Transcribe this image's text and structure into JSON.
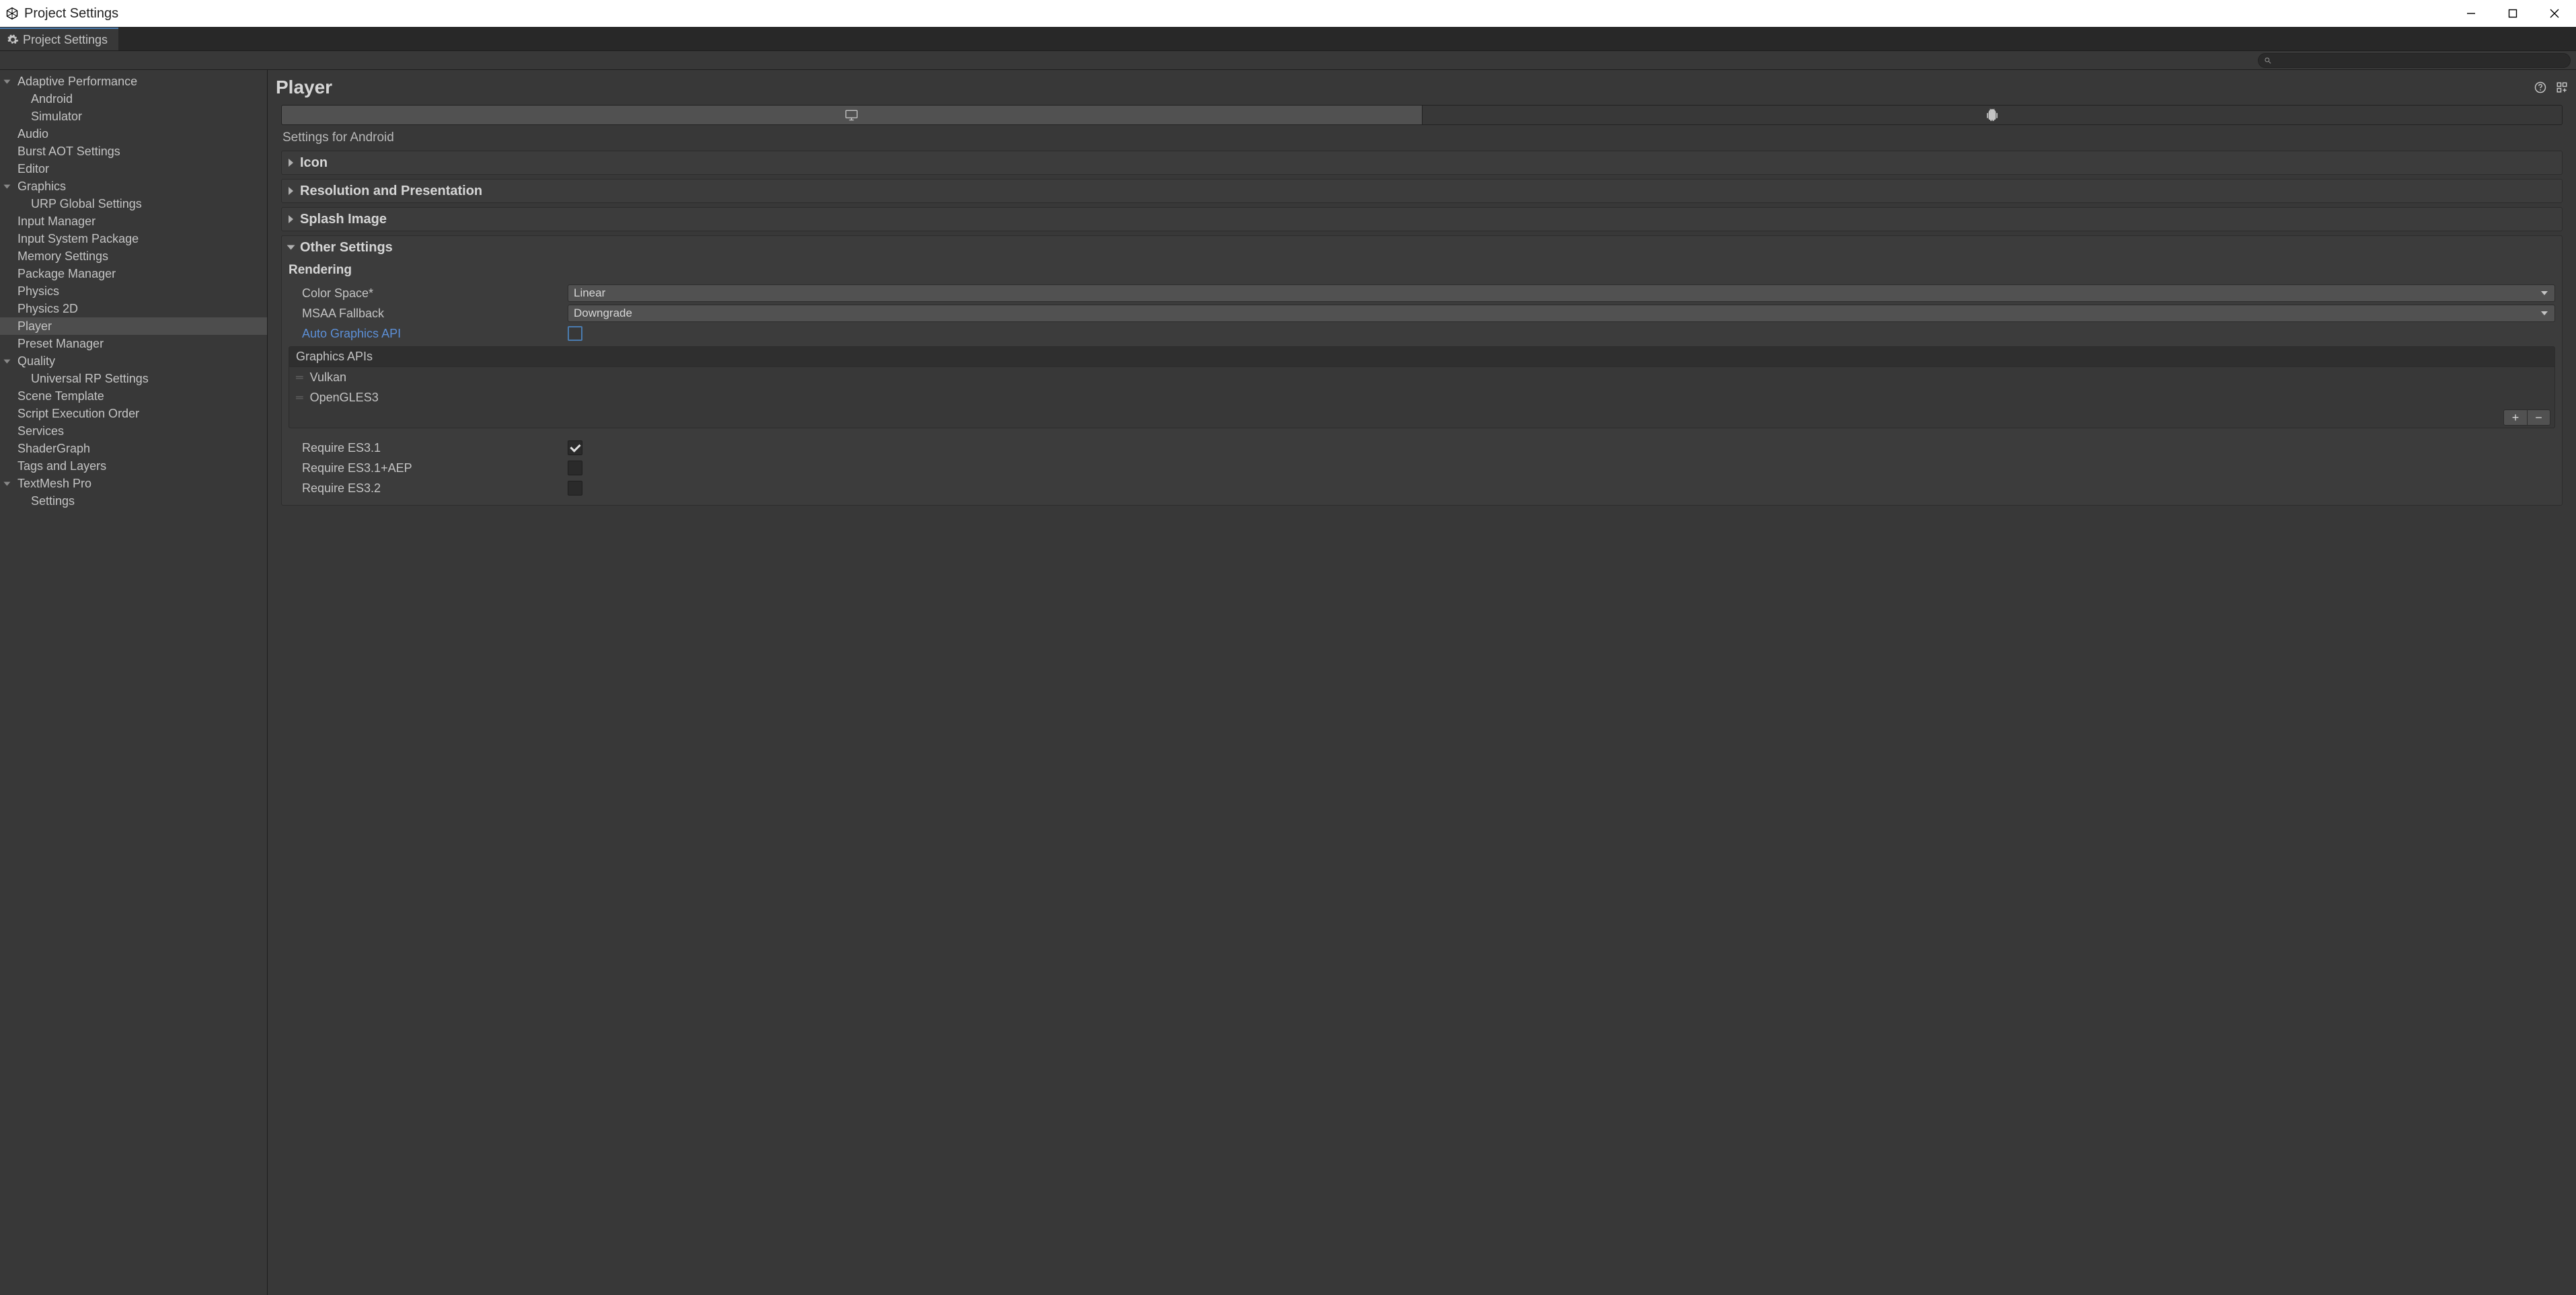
{
  "window": {
    "title": "Project Settings"
  },
  "tab": {
    "label": "Project Settings"
  },
  "search": {
    "placeholder": ""
  },
  "sidebar": {
    "items": [
      {
        "label": "Adaptive Performance",
        "expandable": true,
        "expanded": true,
        "depth": 0
      },
      {
        "label": "Android",
        "depth": 1
      },
      {
        "label": "Simulator",
        "depth": 1
      },
      {
        "label": "Audio",
        "depth": 0
      },
      {
        "label": "Burst AOT Settings",
        "depth": 0
      },
      {
        "label": "Editor",
        "depth": 0
      },
      {
        "label": "Graphics",
        "expandable": true,
        "expanded": true,
        "depth": 0
      },
      {
        "label": "URP Global Settings",
        "depth": 1
      },
      {
        "label": "Input Manager",
        "depth": 0
      },
      {
        "label": "Input System Package",
        "depth": 0
      },
      {
        "label": "Memory Settings",
        "depth": 0
      },
      {
        "label": "Package Manager",
        "depth": 0
      },
      {
        "label": "Physics",
        "depth": 0
      },
      {
        "label": "Physics 2D",
        "depth": 0
      },
      {
        "label": "Player",
        "depth": 0,
        "selected": true
      },
      {
        "label": "Preset Manager",
        "depth": 0
      },
      {
        "label": "Quality",
        "expandable": true,
        "expanded": true,
        "depth": 0
      },
      {
        "label": "Universal RP Settings",
        "depth": 1
      },
      {
        "label": "Scene Template",
        "depth": 0
      },
      {
        "label": "Script Execution Order",
        "depth": 0
      },
      {
        "label": "Services",
        "depth": 0
      },
      {
        "label": "ShaderGraph",
        "depth": 0
      },
      {
        "label": "Tags and Layers",
        "depth": 0
      },
      {
        "label": "TextMesh Pro",
        "expandable": true,
        "expanded": true,
        "depth": 0
      },
      {
        "label": "Settings",
        "depth": 1
      }
    ]
  },
  "page": {
    "title": "Player",
    "platform_tabs": [
      {
        "icon": "monitor",
        "active": false
      },
      {
        "icon": "android",
        "active": true
      }
    ],
    "settings_for_label": "Settings for Android",
    "foldouts": {
      "icon": "Icon",
      "resolution": "Resolution and Presentation",
      "splash": "Splash Image",
      "other": "Other Settings"
    },
    "other": {
      "rendering_header": "Rendering",
      "color_space": {
        "label": "Color Space*",
        "value": "Linear"
      },
      "msaa": {
        "label": "MSAA Fallback",
        "value": "Downgrade"
      },
      "auto_gfx": {
        "label": "Auto Graphics API",
        "checked": false
      },
      "gfx_apis": {
        "header": "Graphics APIs",
        "items": [
          "Vulkan",
          "OpenGLES3"
        ],
        "add_label": "+",
        "remove_label": "−"
      },
      "es31": {
        "label": "Require ES3.1",
        "checked": true
      },
      "es31aep": {
        "label": "Require ES3.1+AEP",
        "checked": false
      },
      "es32": {
        "label": "Require ES3.2",
        "checked": false
      }
    }
  }
}
